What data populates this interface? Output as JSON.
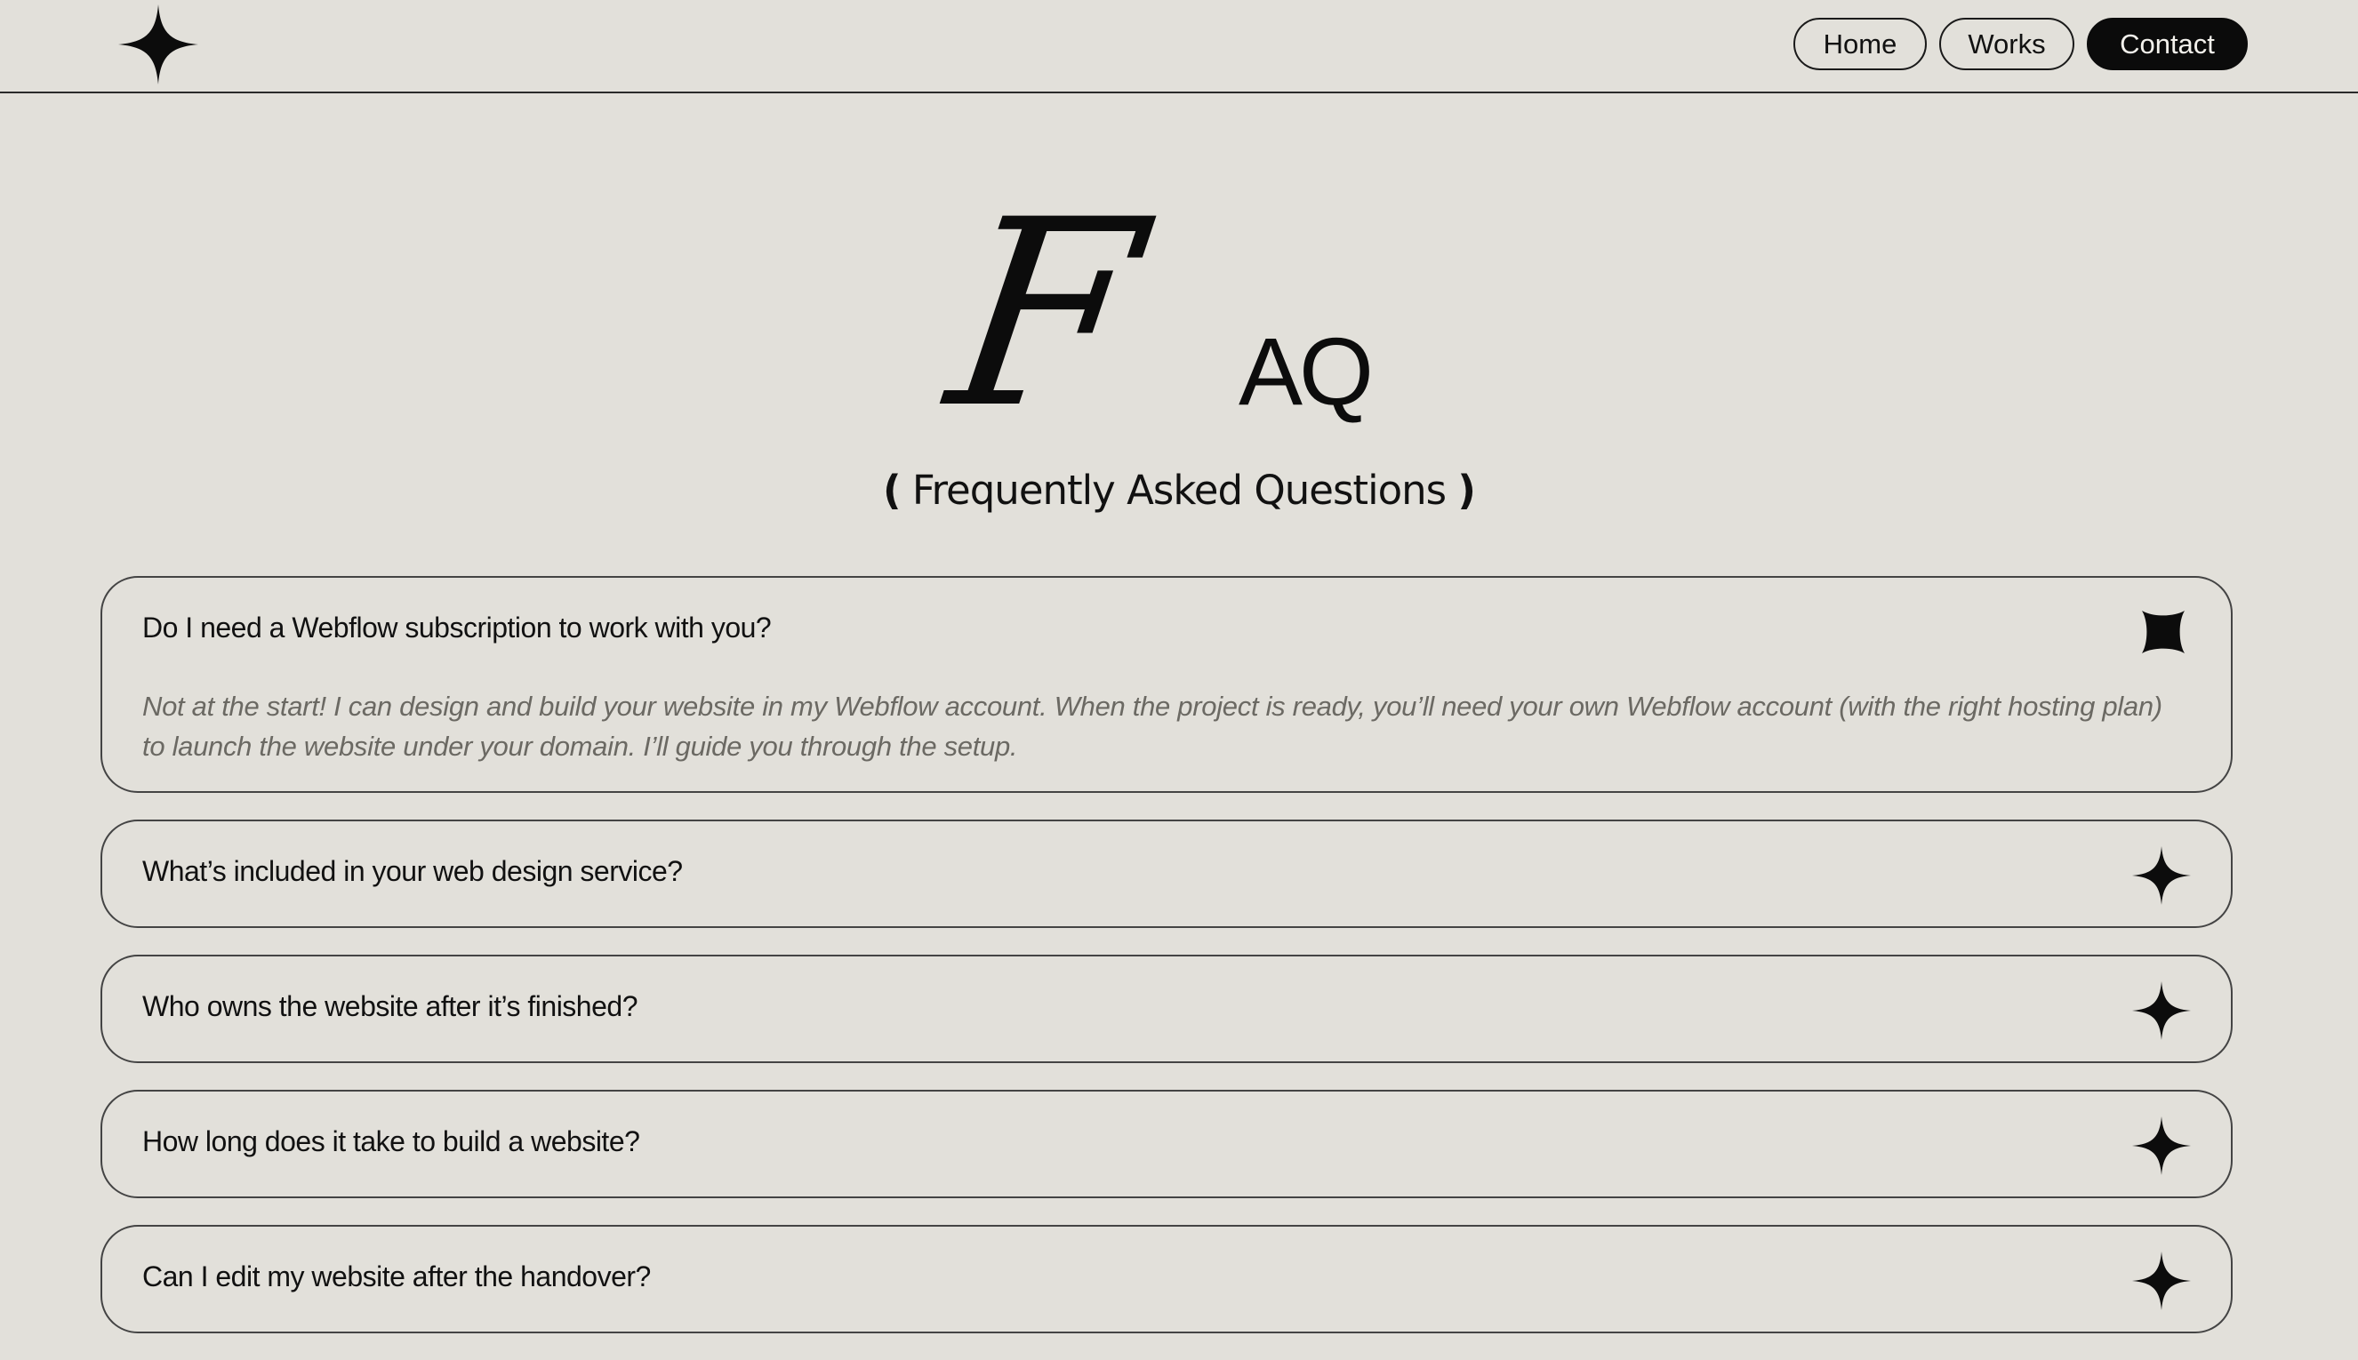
{
  "header": {
    "logo_icon": "four-point-star-icon",
    "nav": [
      {
        "label": "Home",
        "active": false
      },
      {
        "label": "Works",
        "active": false
      },
      {
        "label": "Contact",
        "active": true
      }
    ]
  },
  "hero": {
    "script_letter": "F",
    "title_rest": "AQ",
    "subtitle_open": "(",
    "subtitle_text": " Frequently Asked Questions ",
    "subtitle_close": ")"
  },
  "faq": {
    "items": [
      {
        "question": "Do I need a Webflow subscription to work with you?",
        "answer": "Not at the start! I can design and build your website in my Webflow account. When the project is ready, you’ll need your own Webflow account (with the right hosting plan) to launch the website under your domain. I’ll guide you through the setup.",
        "expanded": true,
        "icon": "close-star-icon"
      },
      {
        "question": "What’s included in your web design service?",
        "expanded": false,
        "icon": "four-point-star-icon"
      },
      {
        "question": "Who owns the website after it’s finished?",
        "expanded": false,
        "icon": "four-point-star-icon"
      },
      {
        "question": "How long does it take to build a website?",
        "expanded": false,
        "icon": "four-point-star-icon"
      },
      {
        "question": "Can I edit my website after the handover?",
        "expanded": false,
        "icon": "four-point-star-icon"
      }
    ]
  },
  "colors": {
    "background": "#e2e0da",
    "text": "#111111",
    "muted_text": "#6b6963",
    "active_nav_bg": "#0b0b0b"
  }
}
